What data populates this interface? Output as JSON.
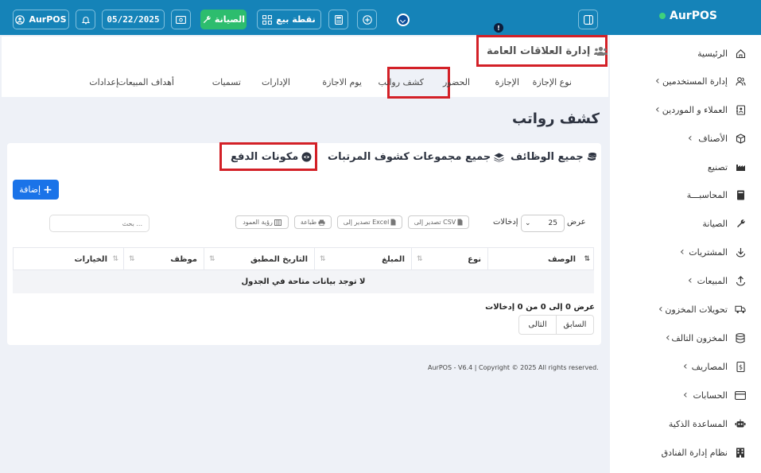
{
  "brand": {
    "name": "AurPOS"
  },
  "topbar": {
    "user_label": "AurPOS",
    "date": "05/22/2025",
    "maintenance_label": "الصيانة",
    "pos_label": "نقطة بيع",
    "info_badge": "!"
  },
  "sidebar": {
    "items": [
      {
        "label": "الرئيسية",
        "icon": "home-icon",
        "has_chevron": false
      },
      {
        "label": "إدارة المستخدمين",
        "icon": "users-icon",
        "has_chevron": true
      },
      {
        "label": "العملاء و الموردين",
        "icon": "contacts-icon",
        "has_chevron": true
      },
      {
        "label": "الأصناف",
        "icon": "box-icon",
        "has_chevron": true
      },
      {
        "label": "تصنيع",
        "icon": "factory-icon",
        "has_chevron": false
      },
      {
        "label": "المحاسبـــة",
        "icon": "book-icon",
        "has_chevron": false
      },
      {
        "label": "الصيانة",
        "icon": "wrench-icon",
        "has_chevron": false
      },
      {
        "label": "المشتريات",
        "icon": "download-icon",
        "has_chevron": true
      },
      {
        "label": "المبيعات",
        "icon": "upload-icon",
        "has_chevron": true
      },
      {
        "label": "تحويلات المخزون",
        "icon": "truck-icon",
        "has_chevron": true
      },
      {
        "label": "المخزون التالف",
        "icon": "database-icon",
        "has_chevron": true
      },
      {
        "label": "المصاريف",
        "icon": "money-icon",
        "has_chevron": true
      },
      {
        "label": "الحسابات",
        "icon": "card-icon",
        "has_chevron": true
      },
      {
        "label": "المساعدة الذكية",
        "icon": "robot-icon",
        "has_chevron": false
      },
      {
        "label": "نظام إدارة الفنادق",
        "icon": "hotel-icon",
        "has_chevron": false
      }
    ]
  },
  "header": {
    "title": "إدارة العلاقات العامة",
    "tabs": [
      "نوع الإجازة",
      "الإجازة",
      "الحضور",
      "كشف رواتب",
      "يوم الاجازة",
      "الإدارات",
      "تسميات",
      "أهداف المبيعات",
      "إعدادات"
    ],
    "active_tab": "كشف رواتب"
  },
  "page": {
    "title": "كشف رواتب"
  },
  "content_tabs": [
    "جميع الوظائف",
    "جميع مجموعات كشوف المرتبات",
    "مكونات الدفع"
  ],
  "toolbar": {
    "add_label": "إضافة",
    "show_label": "عرض",
    "entries_value": "25",
    "entries_label": "إدخالات",
    "export_csv": "تصدير إلى CSV",
    "export_excel": "تصدير إلى Excel",
    "print": "طباعة",
    "column_visibility": "رؤية العمود",
    "search_placeholder": "بحث ..."
  },
  "table": {
    "columns": [
      "الوصف",
      "نوع",
      "المبلغ",
      "التاريخ المطبق",
      "موظف",
      "الخيارات"
    ],
    "empty_message": "لا توجد بيانات متاحة في الجدول",
    "info": "عرض 0 إلى 0 من 0 إدخالات",
    "prev": "السابق",
    "next": "التالى"
  },
  "footer": {
    "text": "AurPOS - V6.4 | Copyright © 2025 All rights reserved."
  },
  "colors": {
    "topbar": "#1583b8",
    "accent": "#1a73e8",
    "highlight": "#d32027",
    "green": "#2dbd6e"
  }
}
